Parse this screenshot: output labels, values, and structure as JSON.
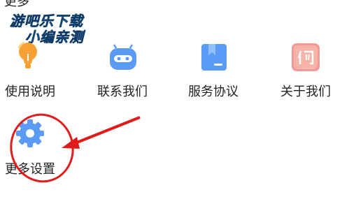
{
  "section": {
    "title": "更多"
  },
  "watermark": {
    "line1": "游吧乐下载",
    "line2": "小编亲测"
  },
  "menu": {
    "items": [
      {
        "label": "使用说明",
        "icon": "lightbulb-icon"
      },
      {
        "label": "联系我们",
        "icon": "robot-icon"
      },
      {
        "label": "服务协议",
        "icon": "document-icon"
      },
      {
        "label": "关于我们",
        "icon": "about-icon"
      },
      {
        "label": "更多设置",
        "icon": "gear-icon"
      }
    ]
  },
  "colors": {
    "accent_orange": "#f7a033",
    "accent_blue": "#5a9cf5",
    "accent_pink": "#f29a9a",
    "annotation_red": "#e01b1b"
  }
}
